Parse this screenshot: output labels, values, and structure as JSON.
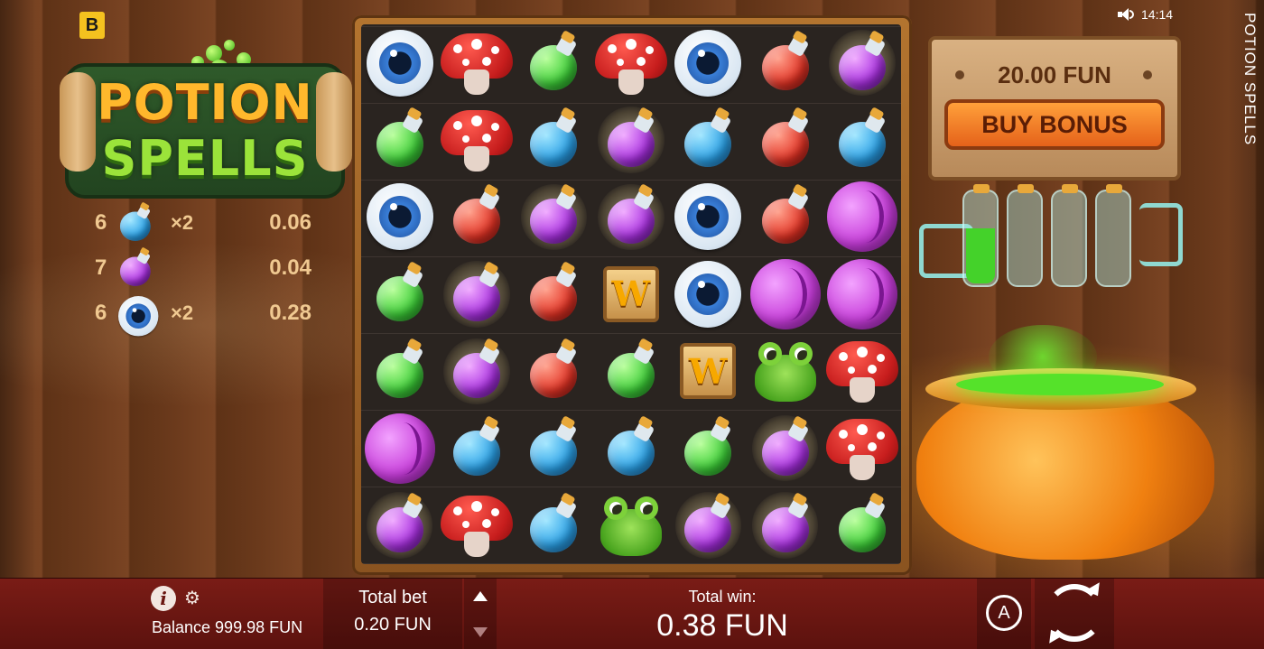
{
  "brand_badge": "B",
  "logo": {
    "line1": "POTION",
    "line2": "SPELLS"
  },
  "status": {
    "time": "14:14",
    "game_title": "POTION SPELLS"
  },
  "wins": [
    {
      "count": "6",
      "symbol": "potion-blue",
      "multiplier": "×2",
      "amount": "0.06"
    },
    {
      "count": "7",
      "symbol": "potion-purple",
      "multiplier": "",
      "amount": "0.04"
    },
    {
      "count": "6",
      "symbol": "eyeball",
      "multiplier": "×2",
      "amount": "0.28"
    }
  ],
  "grid": [
    [
      "eye",
      "mush",
      "green",
      "mush",
      "eye",
      "red",
      "purple*"
    ],
    [
      "green",
      "mush",
      "blue",
      "purple*",
      "blue",
      "red",
      "blue"
    ],
    [
      "eye",
      "red",
      "purple*",
      "purple*",
      "eye",
      "red",
      "shell"
    ],
    [
      "green",
      "purple*",
      "red",
      "wild",
      "eye",
      "shell",
      "shell"
    ],
    [
      "green",
      "purple*",
      "red",
      "green",
      "wild",
      "frog",
      "mush"
    ],
    [
      "shell",
      "blue",
      "blue",
      "blue",
      "green",
      "purple*",
      "mush"
    ],
    [
      "purple*",
      "mush",
      "blue",
      "frog",
      "purple*",
      "purple*",
      "green"
    ]
  ],
  "buy_panel": {
    "value": "20.00 FUN",
    "button_label": "BUY BONUS"
  },
  "tubes_fill": [
    0.6,
    0,
    0,
    0
  ],
  "bottom": {
    "info_label": "i",
    "balance": "Balance 999.98 FUN",
    "total_bet_label": "Total bet",
    "total_bet_value": "0.20 FUN",
    "total_win_label": "Total win:",
    "total_win_value": "0.38 FUN",
    "autoplay_label": "A"
  }
}
